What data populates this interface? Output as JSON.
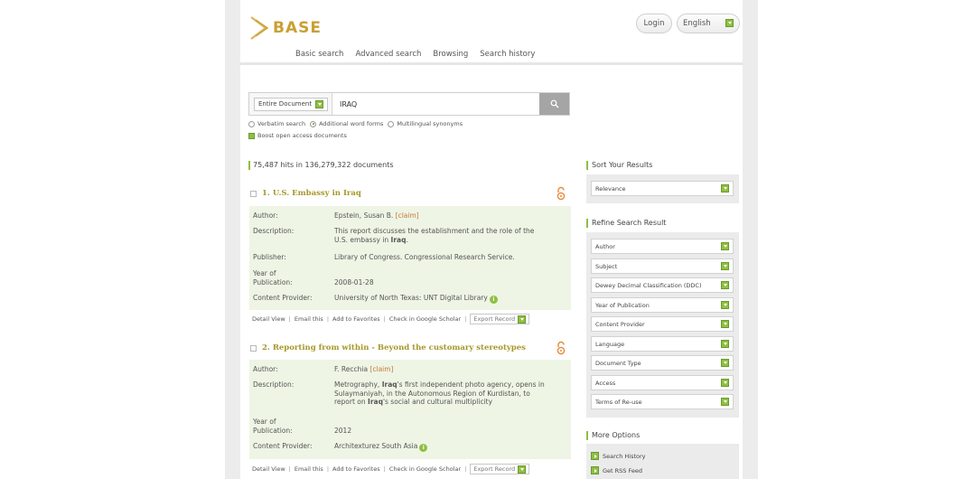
{
  "header": {
    "logo_text": "BASE",
    "login_label": "Login",
    "language_label": "English"
  },
  "nav": [
    "Basic search",
    "Advanced search",
    "Browsing",
    "Search history"
  ],
  "search": {
    "field_label": "Entire Document",
    "query": "IRAQ",
    "options": {
      "verbatim": "Verbatim search",
      "additional": "Additional word forms",
      "multilingual": "Multilingual synonyms",
      "boost": "Boost open access documents"
    }
  },
  "hits_text": "75,487 hits in 136,279,322 documents",
  "results": [
    {
      "title": "1. U.S. Embassy in Iraq",
      "author_label": "Author:",
      "author": "Epstein, Susan B.",
      "claim": "[claim]",
      "description_label": "Description:",
      "description_line1_pre": "This report discusses the establishment and the role of the",
      "description_line2_pre": "U.S. embassy in ",
      "description_line2_bold": "Iraq",
      "description_line2_post": ".",
      "publisher_label": "Publisher:",
      "publisher": "Library of Congress. Congressional Research Service.",
      "year_label_1": "Year of",
      "year_label_2": "Publication:",
      "year": "2008-01-28",
      "provider_label": "Content Provider:",
      "provider": "University of North Texas: UNT Digital Library"
    },
    {
      "title": "2. Reporting from within - Beyond the customary stereotypes",
      "author_label": "Author:",
      "author": "F. Recchia",
      "claim": "[claim]",
      "description_label": "Description:",
      "d1_pre": "Metrography, ",
      "d1_bold": "Iraq",
      "d1_post": "'s first independent photo agency, opens in",
      "d2": "Sulaymaniyah, in the Autonomous Region of Kurdistan, to",
      "d3_pre": "report on ",
      "d3_bold": "Iraq",
      "d3_post": "'s social and cultural multiplicity",
      "year_label_1": "Year of",
      "year_label_2": "Publication:",
      "year": "2012",
      "provider_label": "Content Provider:",
      "provider": "Architexturez South Asia"
    }
  ],
  "result_actions": {
    "detail": "Detail View",
    "email": "Email this",
    "favorites": "Add to Favorites",
    "scholar": "Check in Google Scholar",
    "export": "Export Record"
  },
  "sidebar": {
    "sort_title": "Sort Your Results",
    "sort_value": "Relevance",
    "refine_title": "Refine Search Result",
    "facets": [
      "Author",
      "Subject",
      "Dewey Decimal Classification (DDC)",
      "Year of Publication",
      "Content Provider",
      "Language",
      "Document Type",
      "Access",
      "Terms of Re-use"
    ],
    "more_title": "More Options",
    "more_items": [
      "Search History",
      "Get RSS Feed"
    ]
  },
  "colors": {
    "accent_green": "#8fbf42",
    "title_gold": "#a6982a",
    "open_access_orange": "#e8883a"
  }
}
